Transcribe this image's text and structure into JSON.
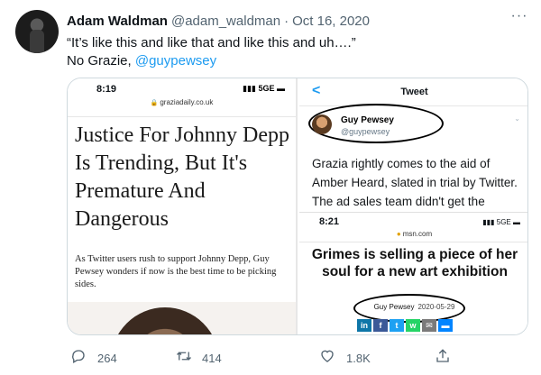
{
  "tweet": {
    "author_name": "Adam Waldman",
    "author_handle": "@adam_waldman",
    "separator": "·",
    "date": "Oct 16, 2020",
    "more_icon": "more-horizontal-icon",
    "text_line1": "“It’s like this and like that and like this and uh….”",
    "text_line2_prefix": "No Grazie, ",
    "text_line2_mention": "@guypewsey"
  },
  "left_image": {
    "time": "8:19",
    "signal": "▮▮▮ 5GE ▬",
    "url": "graziadaily.co.uk",
    "headline": "Justice For Johnny Depp Is Trending, But It's Premature And Dangerous",
    "standfirst": "As Twitter users rush to support Johnny Depp, Guy Pewsey wonders if now is the best time to be picking sides."
  },
  "right_image": {
    "back_glyph": "<",
    "title": "Tweet",
    "user_name": "Guy Pewsey",
    "user_handle": "@guypewsey",
    "chevron": "⌄",
    "quote": "Grazia rightly comes to the aid of Amber Heard, slated in trial by Twitter. The ad sales team didn't get the",
    "inset": {
      "time": "8:21",
      "signal": "▮▮▮ 5GE ▬",
      "url": "msn.com",
      "headline": "Grimes is selling a piece of her soul for a new art exhibition",
      "byline_name": "Guy Pewsey",
      "byline_date": "2020-05-29",
      "shares": [
        "in",
        "f",
        "t",
        "w",
        "✉",
        "▬"
      ]
    }
  },
  "actions": {
    "reply_count": "264",
    "retweet_count": "414",
    "like_count": "1.8K",
    "reply_icon": "reply-icon",
    "retweet_icon": "retweet-icon",
    "like_icon": "heart-icon",
    "share_icon": "share-icon"
  },
  "colors": {
    "accent": "#1d9bf0",
    "text_secondary": "#536471",
    "border": "#cfd9de"
  }
}
